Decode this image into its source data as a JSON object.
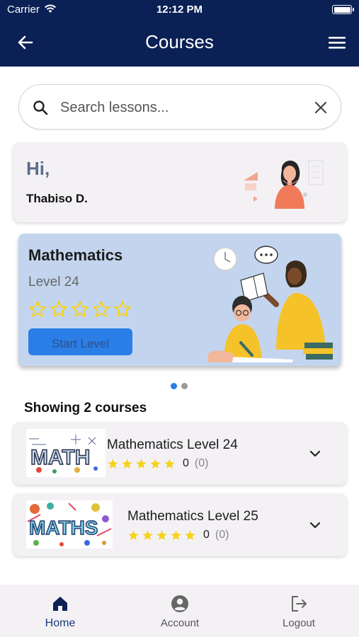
{
  "status_bar": {
    "carrier": "Carrier",
    "time": "12:12 PM"
  },
  "app_bar": {
    "title": "Courses"
  },
  "search": {
    "placeholder": "Search lessons..."
  },
  "greeting": {
    "hi": "Hi,",
    "name": "Thabiso D."
  },
  "featured": {
    "subject": "Mathematics",
    "level": "Level 24",
    "rating": 0,
    "max_rating": 5,
    "button_label": "Start Level",
    "active_page": 1,
    "page_count": 2
  },
  "courses": {
    "heading": "Showing 2 courses",
    "items": [
      {
        "title": "Mathematics Level 24",
        "rating_value": "0",
        "rating_count": "(0)",
        "stars": 5
      },
      {
        "title": "Mathematics Level 25",
        "rating_value": "0",
        "rating_count": "(0)",
        "stars": 5
      }
    ]
  },
  "bottom_nav": {
    "items": [
      {
        "label": "Home",
        "icon": "home-icon",
        "active": true
      },
      {
        "label": "Account",
        "icon": "account-circle-icon",
        "active": false
      },
      {
        "label": "Logout",
        "icon": "logout-icon",
        "active": false
      }
    ]
  },
  "colors": {
    "app_bar": "#0b2155",
    "accent": "#2a7ee6",
    "star": "#f5d31a",
    "card": "#f4f1f5",
    "featured_card": "#c3d5ee"
  }
}
